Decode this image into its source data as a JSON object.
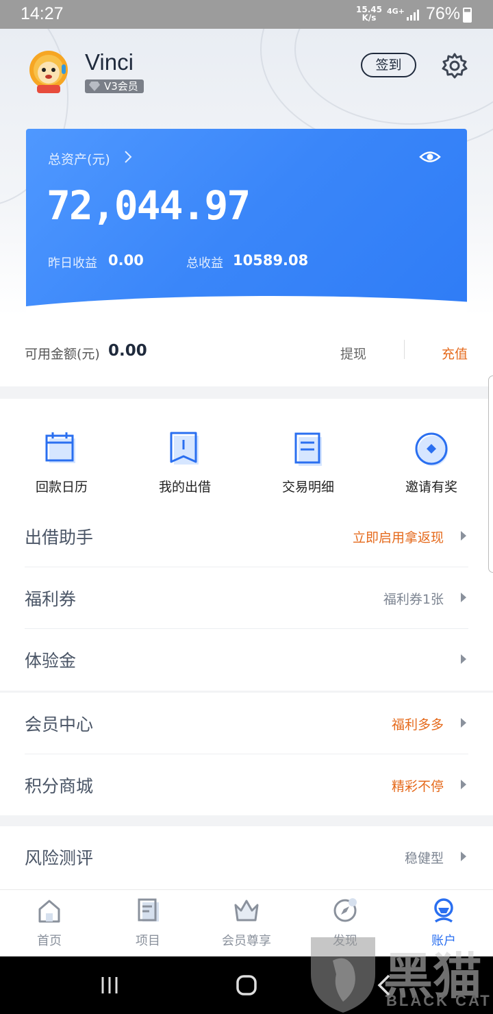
{
  "status_bar": {
    "time": "14:27",
    "speed_value": "15.45",
    "speed_unit": "K/s",
    "network": "4G+",
    "battery": "76%"
  },
  "header": {
    "username": "Vinci",
    "vip_level": "V3会员",
    "signin_label": "签到",
    "settings_icon": "gear-icon",
    "avatar_icon": "lion-mascot-avatar"
  },
  "asset_card": {
    "total_label": "总资产(元)",
    "total_value": "72,044.97",
    "yesterday_label": "昨日收益",
    "yesterday_value": "0.00",
    "total_earnings_label": "总收益",
    "total_earnings_value": "10589.08",
    "gradient_start": "#4f98ff",
    "gradient_end": "#2f7cf6"
  },
  "balance": {
    "label": "可用金额(元)",
    "value": "0.00",
    "withdraw_label": "提现",
    "recharge_label": "充值",
    "recharge_color": "#e56a1c"
  },
  "quick_actions": [
    {
      "label": "回款日历",
      "icon": "calendar-icon"
    },
    {
      "label": "我的出借",
      "icon": "bookmark-icon"
    },
    {
      "label": "交易明细",
      "icon": "document-icon"
    },
    {
      "label": "邀请有奖",
      "icon": "invite-icon"
    }
  ],
  "menu_group_1": [
    {
      "title": "出借助手",
      "hint": "立即启用拿返现"
    },
    {
      "title": "福利券",
      "hint": "福利券1张"
    },
    {
      "title": "体验金",
      "hint": ""
    }
  ],
  "menu_group_2": [
    {
      "title": "会员中心",
      "hint": "福利多多"
    },
    {
      "title": "积分商城",
      "hint": "精彩不停"
    }
  ],
  "menu_group_3": [
    {
      "title": "风险测评",
      "hint": "稳健型"
    }
  ],
  "tab_bar": [
    {
      "label": "首页",
      "icon": "home-icon",
      "active": false
    },
    {
      "label": "项目",
      "icon": "list-doc-icon",
      "active": false
    },
    {
      "label": "会员尊享",
      "icon": "crown-icon",
      "active": false
    },
    {
      "label": "发现",
      "icon": "compass-icon",
      "active": false
    },
    {
      "label": "账户",
      "icon": "account-icon",
      "active": true
    }
  ],
  "accent_color": "#2a6ff0",
  "watermark": {
    "text": "BLACK CAT",
    "big_text": "黑猫"
  }
}
